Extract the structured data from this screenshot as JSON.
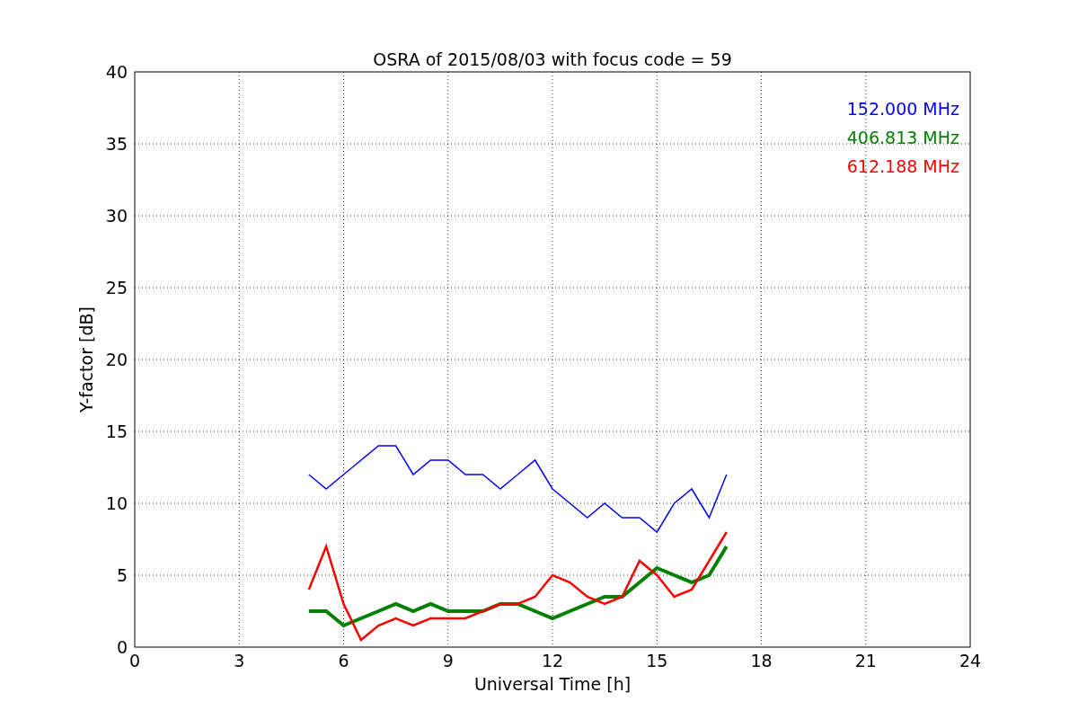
{
  "figure": {
    "chart_data": {
      "type": "line",
      "title": "OSRA of 2015/08/03 with focus code = 59",
      "xlabel": "Universal Time [h]",
      "ylabel": "Y-factor [dB]",
      "x": [
        5,
        5.5,
        6,
        6.5,
        7,
        7.5,
        8,
        8.5,
        9,
        9.5,
        10,
        10.5,
        11,
        11.5,
        12,
        12.5,
        13,
        13.5,
        14,
        14.5,
        15,
        15.5,
        16,
        16.5,
        17
      ],
      "series": [
        {
          "name": "152.000 MHz",
          "color": "#0000ff",
          "values": [
            12,
            11,
            12,
            13,
            14,
            14,
            12,
            13,
            13,
            12,
            12,
            11,
            12,
            13,
            11,
            10,
            9,
            10,
            9,
            9,
            8,
            10,
            11,
            9,
            12
          ]
        },
        {
          "name": "406.813 MHz",
          "color": "#008000",
          "values": [
            2.5,
            2.5,
            1.5,
            2,
            2.5,
            3,
            2.5,
            3,
            2.5,
            2.5,
            2.5,
            3,
            3,
            2.5,
            2,
            2.5,
            3,
            3.5,
            3.5,
            4.5,
            5.5,
            5,
            4.5,
            5,
            7
          ]
        },
        {
          "name": "612.188 MHz",
          "color": "#ff0000",
          "values": [
            4,
            7,
            3,
            0.5,
            1.5,
            2,
            1.5,
            2,
            2,
            2,
            2.5,
            3,
            3,
            3.5,
            5,
            4.5,
            3.5,
            3,
            3.5,
            6,
            5,
            3.5,
            4,
            6,
            8
          ]
        }
      ],
      "xlim": [
        0,
        24
      ],
      "ylim": [
        0,
        40
      ],
      "xticks": [
        0,
        3,
        6,
        9,
        12,
        15,
        18,
        21,
        24
      ],
      "yticks": [
        0,
        5,
        10,
        15,
        20,
        25,
        30,
        35,
        40
      ],
      "grid": true
    }
  }
}
